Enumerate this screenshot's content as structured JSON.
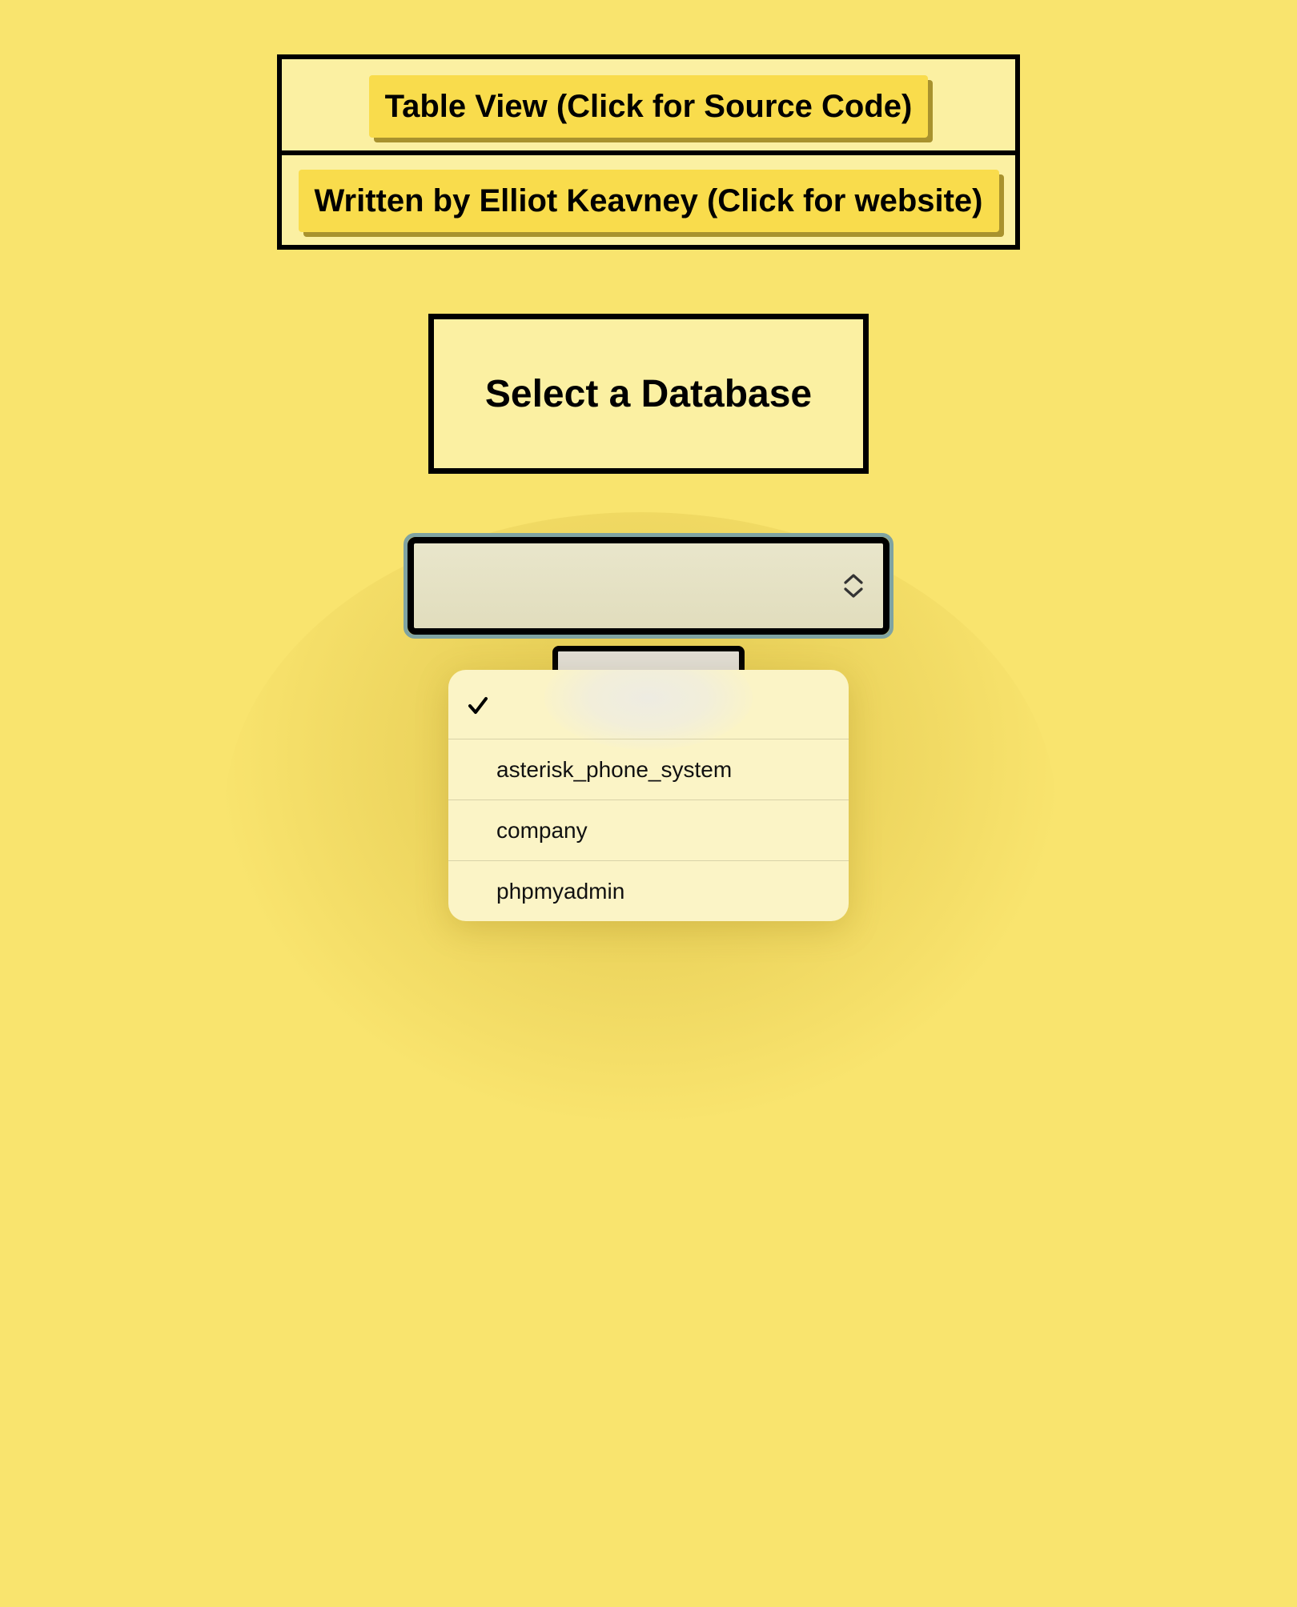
{
  "header": {
    "source_link_label": "Table View (Click for Source Code)",
    "author_link_label": "Written by Elliot Keavney (Click for website)"
  },
  "title": "Select a Database",
  "database_select": {
    "selected_value": "",
    "options": [
      "",
      "asterisk_phone_system",
      "company",
      "phpmyadmin"
    ]
  },
  "colors": {
    "background": "#f9e46e",
    "panel": "#fbf0a2",
    "button": "#f9dc4c",
    "focus_ring": "#7fa3a2"
  }
}
